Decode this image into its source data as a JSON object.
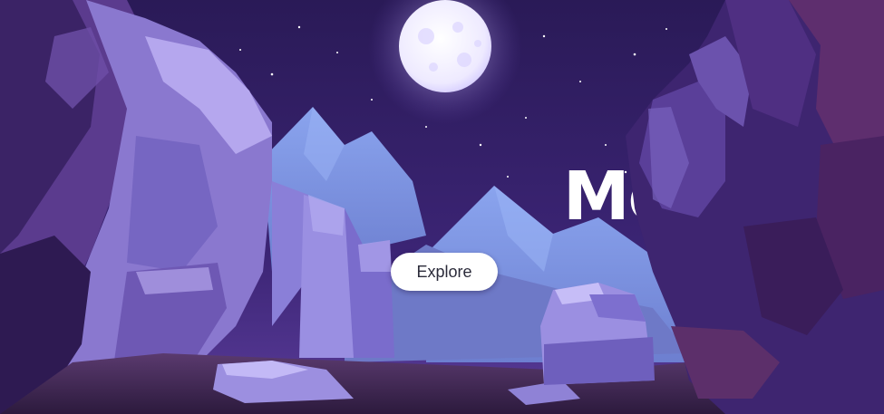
{
  "hero": {
    "title": "Mo",
    "button_label": "Explore"
  },
  "colors": {
    "sky_top": "#2a1a57",
    "sky_bottom": "#4b2f8c",
    "moon": "#f4f1ff",
    "mountain_far": "#7a8fde",
    "mountain_mid": "#6b78c9",
    "cliff_light": "#8d7fd6",
    "cliff_dark": "#3a2560",
    "ground": "#4a2d5c",
    "button_bg": "#ffffff",
    "title_color": "#ffffff"
  },
  "icons": {
    "moon": "moon-illustration",
    "stars": "star-dots"
  }
}
